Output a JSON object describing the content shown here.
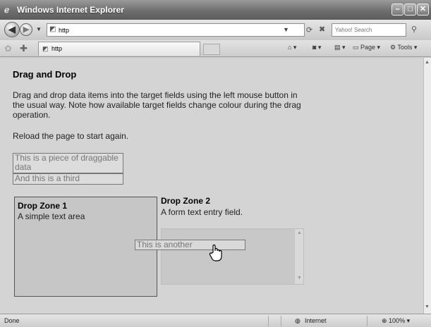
{
  "window": {
    "title": "Windows Internet Explorer"
  },
  "address": {
    "url": "http",
    "search_placeholder": "Yahoo! Search"
  },
  "tab": {
    "label": "http"
  },
  "commands": {
    "page": "Page",
    "tools": "Tools"
  },
  "page": {
    "heading": "Drag and Drop",
    "intro": "Drag and drop data items into the target fields using the left mouse button in the usual way. Note how available target fields change colour during the drag operation.",
    "reload_note": "Reload the page to start again.",
    "draggable_items": [
      "This is a piece of draggable data",
      "And this is a third"
    ],
    "dragging_item": "This is another",
    "drop_zone_1": {
      "title": "Drop Zone 1",
      "desc": "A simple text area"
    },
    "drop_zone_2": {
      "title": "Drop Zone 2",
      "desc": "A form text entry field."
    }
  },
  "status": {
    "left": "Done",
    "zone": "Internet",
    "zoom": "100%"
  },
  "icons": [
    "ie-icon",
    "back-icon",
    "forward-icon",
    "refresh-icon",
    "stop-icon",
    "search-icon",
    "favorites-star-icon",
    "add-favorites-icon",
    "home-icon",
    "feeds-icon",
    "print-icon",
    "page-icon",
    "tools-icon",
    "globe-icon",
    "zoom-icon",
    "hand-cursor-icon"
  ]
}
